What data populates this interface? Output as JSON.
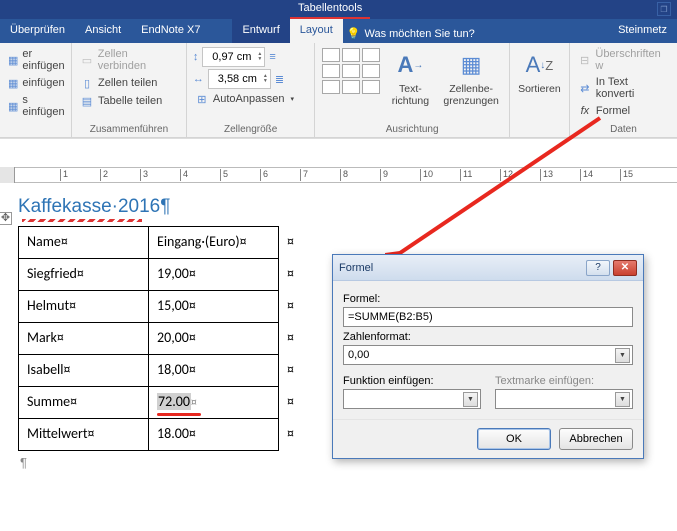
{
  "title_context": "Tabellentools",
  "tabs": {
    "review": "Überprüfen",
    "view": "Ansicht",
    "endnote": "EndNote X7",
    "design": "Entwurf",
    "layout": "Layout",
    "tellme": "Was möchten Sie tun?",
    "extra": "Steinmetz"
  },
  "ribbon": {
    "insert_above_suffix": "er einfügen",
    "insert_below_suffix": "einfügen",
    "insert_right_suffix": "s einfügen",
    "group_merge": "Zusammenführen",
    "merge_cells": "Zellen verbinden",
    "split_cells": "Zellen teilen",
    "split_table": "Tabelle teilen",
    "group_cellsize": "Zellengröße",
    "height_val": "0,97 cm",
    "width_val": "3,58 cm",
    "autofit": "AutoAnpassen",
    "group_align": "Ausrichtung",
    "text_dir": "Text-\nrichtung",
    "cell_margins": "Zellenbe-\ngrenzungen",
    "sort": "Sortieren",
    "repeat_header": "Überschriften w",
    "convert_text": "In Text konverti",
    "formula": "Formel",
    "group_data": "Daten"
  },
  "doc": {
    "heading": "Kaffekasse·2016¶",
    "col1": "Name¤",
    "col2": "Eingang·(Euro)¤",
    "rows": [
      {
        "n": "Siegfried¤",
        "v": "19,00¤"
      },
      {
        "n": "Helmut¤",
        "v": "15,00¤"
      },
      {
        "n": "Mark¤",
        "v": "20,00¤"
      },
      {
        "n": "Isabell¤",
        "v": "18,00¤"
      }
    ],
    "sum_label": "Summe¤",
    "sum_val": "72.00",
    "avg_label": "Mittelwert¤",
    "avg_val": "18.00¤",
    "eoc": "¤",
    "para": "¶"
  },
  "dialog": {
    "title": "Formel",
    "lab_formula": "Formel:",
    "val_formula": "=SUMME(B2:B5)",
    "lab_numfmt": "Zahlenformat:",
    "val_numfmt": "0,00",
    "lab_func": "Funktion einfügen:",
    "lab_bookmark": "Textmarke einfügen:",
    "ok": "OK",
    "cancel": "Abbrechen"
  }
}
